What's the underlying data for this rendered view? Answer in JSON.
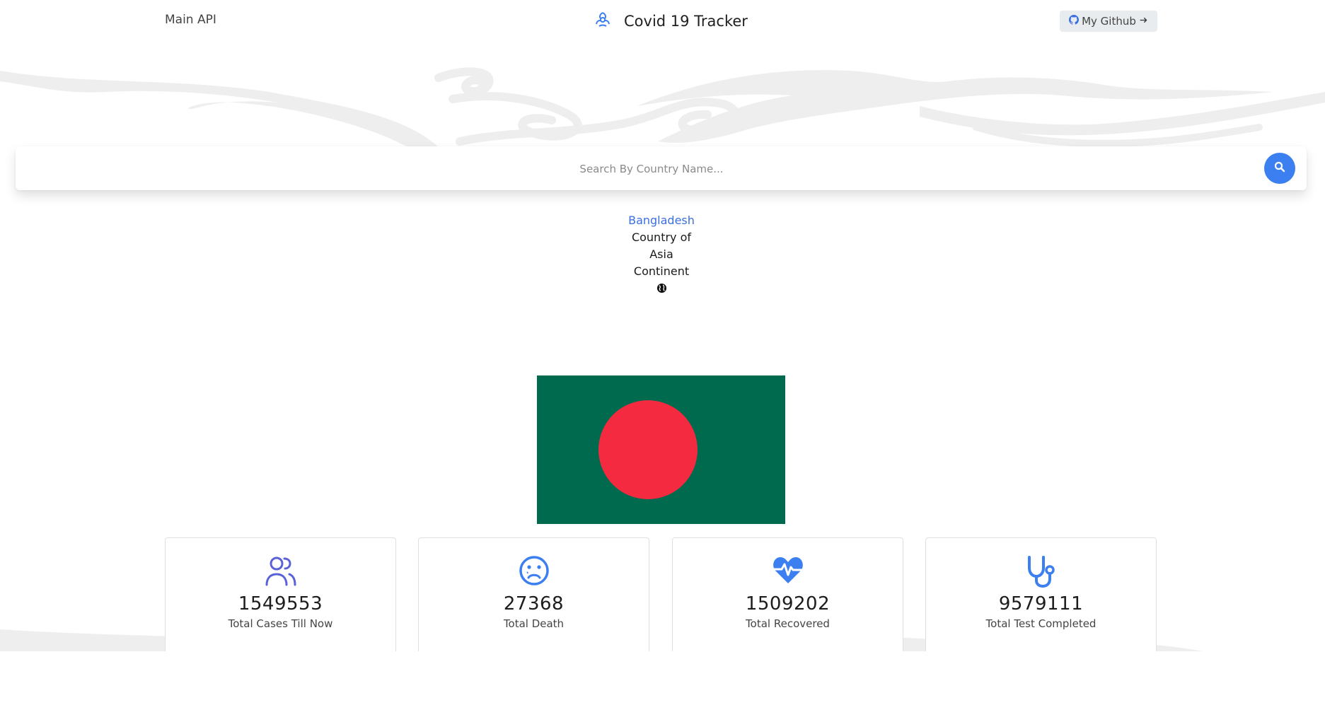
{
  "header": {
    "nav_link": "Main API",
    "brand_icon": "biohazard-icon",
    "brand_title": "Covid 19 Tracker",
    "github_label": "My Github",
    "github_icon": "github-icon",
    "github_arrow_icon": "arrow-right-icon"
  },
  "search": {
    "placeholder": "Search By Country Name...",
    "value": "",
    "button_icon": "search-icon"
  },
  "country": {
    "name": "Bangladesh",
    "line1": "Country of",
    "line2": "Asia",
    "line3": "Continent",
    "globe_icon": "globe-icon",
    "flag_colors": {
      "field": "#006a4e",
      "disc": "#f42a41"
    }
  },
  "stats": [
    {
      "icon": "users-icon",
      "value": "1549553",
      "label": "Total Cases Till Now",
      "color": "#5b61d6"
    },
    {
      "icon": "sad-face-icon",
      "value": "27368",
      "label": "Total Death",
      "color": "#3b7ff0"
    },
    {
      "icon": "heartbeat-icon",
      "value": "1509202",
      "label": "Total Recovered",
      "color": "#3b7ff0"
    },
    {
      "icon": "stethoscope-icon",
      "value": "9579111",
      "label": "Total Test Completed",
      "color": "#3b7ff0"
    }
  ],
  "colors": {
    "accent": "#3b7ff0",
    "link": "#3b6fe0"
  }
}
